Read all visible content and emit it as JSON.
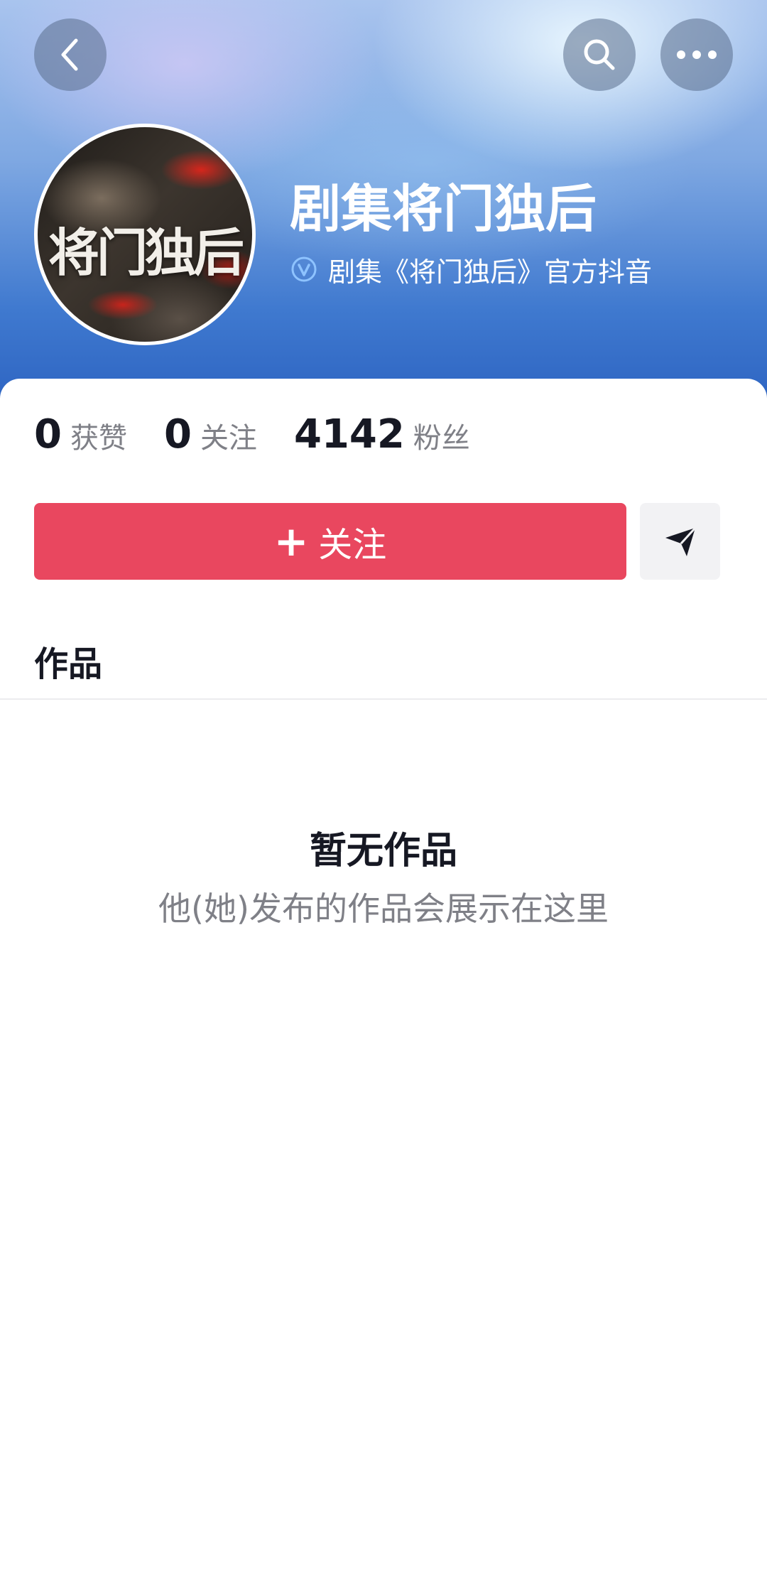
{
  "header": {
    "back_icon": "chevron-left-icon",
    "search_icon": "search-icon",
    "more_icon": "more-horizontal-icon"
  },
  "profile": {
    "avatar_text": "将门独后",
    "name": "剧集将门独后",
    "verify_icon": "verified-badge-icon",
    "verify_text": "剧集《将门独后》官方抖音"
  },
  "stats": [
    {
      "value": "0",
      "label": "获赞"
    },
    {
      "value": "0",
      "label": "关注"
    },
    {
      "value": "4142",
      "label": "粉丝"
    }
  ],
  "actions": {
    "follow_plus": "+",
    "follow_label": "关注",
    "follow_color": "#e9475f",
    "share_icon": "paper-plane-icon"
  },
  "tabs": {
    "works_label": "作品"
  },
  "empty_state": {
    "title": "暂无作品",
    "description": "他(她)发布的作品会展示在这里"
  }
}
